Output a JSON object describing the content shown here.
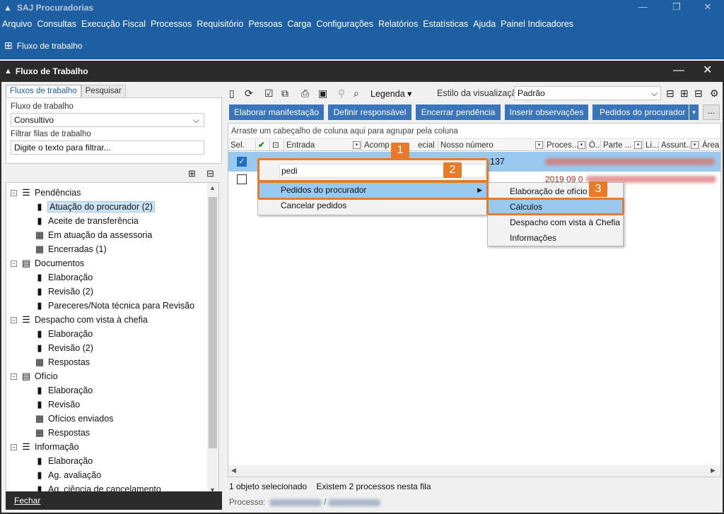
{
  "app": {
    "title": "SAJ Procuradorias"
  },
  "menu": [
    "Arquivo",
    "Consultas",
    "Execução Fiscal",
    "Processos",
    "Requisitório",
    "Pessoas",
    "Carga",
    "Configurações",
    "Relatórios",
    "Estatísticas",
    "Ajuda",
    "Painel Indicadores"
  ],
  "app_toolbar": {
    "workflow_label": "Fluxo de trabalho"
  },
  "window": {
    "title": "Fluxo de Trabalho",
    "close": "✕"
  },
  "left": {
    "tabs": [
      "Fluxos de trabalho",
      "Pesquisar"
    ],
    "flow_label": "Fluxo de trabalho",
    "flow_value": "Consultivo",
    "filter_label": "Filtrar filas de trabalho",
    "filter_placeholder": "Digite o texto para filtrar...",
    "tree": [
      {
        "label": "Pendências",
        "level": 0
      },
      {
        "label": "Atuação do procurador (2)",
        "level": 1,
        "selected": true
      },
      {
        "label": "Aceite de transferência",
        "level": 1
      },
      {
        "label": "Em atuação da assessoria",
        "level": 1
      },
      {
        "label": "Encerradas (1)",
        "level": 1
      },
      {
        "label": "Documentos",
        "level": 0
      },
      {
        "label": "Elaboração",
        "level": 1
      },
      {
        "label": "Revisão (2)",
        "level": 1
      },
      {
        "label": "Pareceres/Nota técnica para Revisão",
        "level": 1
      },
      {
        "label": "Despacho com vista à chefia",
        "level": 0
      },
      {
        "label": "Elaboração",
        "level": 1
      },
      {
        "label": "Revisão (2)",
        "level": 1
      },
      {
        "label": "Respostas",
        "level": 1
      },
      {
        "label": "Ofício",
        "level": 0
      },
      {
        "label": "Elaboração",
        "level": 1
      },
      {
        "label": "Revisão",
        "level": 1
      },
      {
        "label": "Ofícios enviados",
        "level": 1
      },
      {
        "label": "Respostas",
        "level": 1
      },
      {
        "label": "Informação",
        "level": 0
      },
      {
        "label": "Elaboração",
        "level": 1
      },
      {
        "label": "Ag. avaliação",
        "level": 1
      },
      {
        "label": "Ag. ciência de cancelamento",
        "level": 1
      }
    ],
    "close_button": "Fechar"
  },
  "right": {
    "legenda": "Legenda",
    "view_style_label": "Estilo da visualização",
    "view_style_value": "Padrão",
    "actions": [
      "Elaborar manifestação",
      "Definir responsável",
      "Encerrar pendência",
      "Inserir observações",
      "Pedidos do procurador"
    ],
    "more": "...",
    "group_hint": "Arraste um cabeçalho de coluna aqui para agrupar pela coluna",
    "columns": [
      "Sel.",
      "Entrada",
      "Acomp",
      "ecial",
      "Nosso número",
      "Proces...",
      "Ó...",
      "Parte ...",
      "Li...",
      "Assunt...",
      "Área"
    ],
    "row1_num": "137",
    "row2_num": "2019 09 0",
    "status_selected": "1 objeto selecionado",
    "status_count": "Existem 2 processos nesta fila",
    "process_label": "Processo:"
  },
  "context_menu": {
    "search_value": "pedi",
    "items": [
      "Pedidos do procurador",
      "Cancelar pedidos"
    ],
    "submenu": [
      "Elaboração de ofício",
      "Cálculos",
      "Despacho com vista à Chefia",
      "Informações"
    ]
  },
  "callouts": [
    "1",
    "2",
    "3"
  ],
  "colors": {
    "brand": "#1e5fa3",
    "button": "#3a75b9",
    "highlight": "#99c9ef",
    "callout": "#e87b2a",
    "inner_bar": "#2b2b2b"
  }
}
